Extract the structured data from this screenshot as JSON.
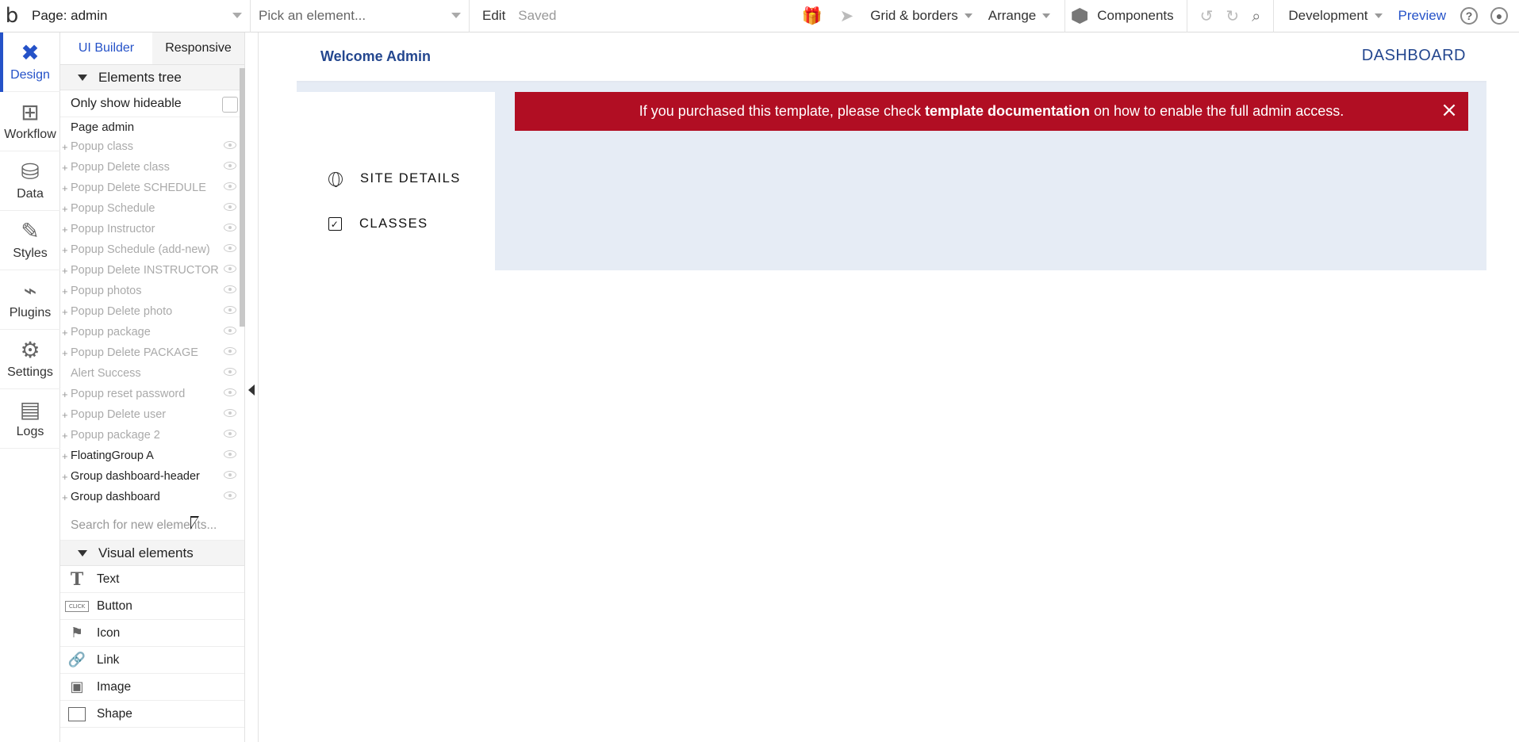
{
  "topbar": {
    "logo": "b",
    "page_select": "Page: admin",
    "element_picker_placeholder": "Pick an element...",
    "edit": "Edit",
    "saved": "Saved",
    "grid_borders": "Grid & borders",
    "arrange": "Arrange",
    "components": "Components",
    "environment": "Development",
    "preview": "Preview",
    "help": "?"
  },
  "leftnav": {
    "items": [
      {
        "label": "Design",
        "icon": "design-icon",
        "glyph": "✖"
      },
      {
        "label": "Workflow",
        "icon": "workflow-icon",
        "glyph": "⊞"
      },
      {
        "label": "Data",
        "icon": "database-icon",
        "glyph": "⛁"
      },
      {
        "label": "Styles",
        "icon": "brush-icon",
        "glyph": "✎"
      },
      {
        "label": "Plugins",
        "icon": "plug-icon",
        "glyph": "⌁"
      },
      {
        "label": "Settings",
        "icon": "gear-icon",
        "glyph": "⚙"
      },
      {
        "label": "Logs",
        "icon": "document-icon",
        "glyph": "▤"
      }
    ]
  },
  "panel": {
    "tabs": [
      "UI Builder",
      "Responsive"
    ],
    "elements_tree_label": "Elements tree",
    "only_show_hideable": "Only show hideable",
    "tree_root": "Page admin",
    "tree_items": [
      {
        "label": "Popup class",
        "plus": true,
        "dark": false
      },
      {
        "label": "Popup Delete class",
        "plus": true,
        "dark": false
      },
      {
        "label": "Popup Delete SCHEDULE",
        "plus": true,
        "dark": false
      },
      {
        "label": "Popup Schedule",
        "plus": true,
        "dark": false
      },
      {
        "label": "Popup Instructor",
        "plus": true,
        "dark": false
      },
      {
        "label": "Popup Schedule (add-new)",
        "plus": true,
        "dark": false
      },
      {
        "label": "Popup Delete INSTRUCTOR",
        "plus": true,
        "dark": false
      },
      {
        "label": "Popup photos",
        "plus": true,
        "dark": false
      },
      {
        "label": "Popup Delete photo",
        "plus": true,
        "dark": false
      },
      {
        "label": "Popup package",
        "plus": true,
        "dark": false
      },
      {
        "label": "Popup Delete PACKAGE",
        "plus": true,
        "dark": false
      },
      {
        "label": "Alert Success",
        "plus": false,
        "dark": false
      },
      {
        "label": "Popup reset password",
        "plus": true,
        "dark": false
      },
      {
        "label": "Popup Delete user",
        "plus": true,
        "dark": false
      },
      {
        "label": "Popup package 2",
        "plus": true,
        "dark": false
      },
      {
        "label": "FloatingGroup A",
        "plus": true,
        "dark": true
      },
      {
        "label": "Group dashboard-header",
        "plus": true,
        "dark": true
      },
      {
        "label": "Group dashboard",
        "plus": true,
        "dark": true
      }
    ],
    "search_placeholder": "Search for new elements...",
    "visual_elements_label": "Visual elements",
    "visual_elements": [
      {
        "label": "Text",
        "icon": "text-icon"
      },
      {
        "label": "Button",
        "icon": "button-icon"
      },
      {
        "label": "Icon",
        "icon": "flag-icon"
      },
      {
        "label": "Link",
        "icon": "link-icon"
      },
      {
        "label": "Image",
        "icon": "image-icon"
      },
      {
        "label": "Shape",
        "icon": "shape-icon"
      }
    ]
  },
  "canvas": {
    "welcome": "Welcome Admin",
    "dashboard": "DASHBOARD",
    "menu": [
      {
        "label": "SITE DETAILS",
        "icon": "globe-icon"
      },
      {
        "label": "CLASSES",
        "icon": "checkbox-icon"
      }
    ],
    "alert": {
      "before": "If you purchased this template, please check ",
      "bold": "template documentation",
      "after": " on how to enable the full admin access.",
      "close": "×",
      "color": "#b10e23"
    }
  },
  "colors": {
    "accent": "#2552c8",
    "heading": "#24478f",
    "canvas_bg": "#e6ecf5"
  }
}
